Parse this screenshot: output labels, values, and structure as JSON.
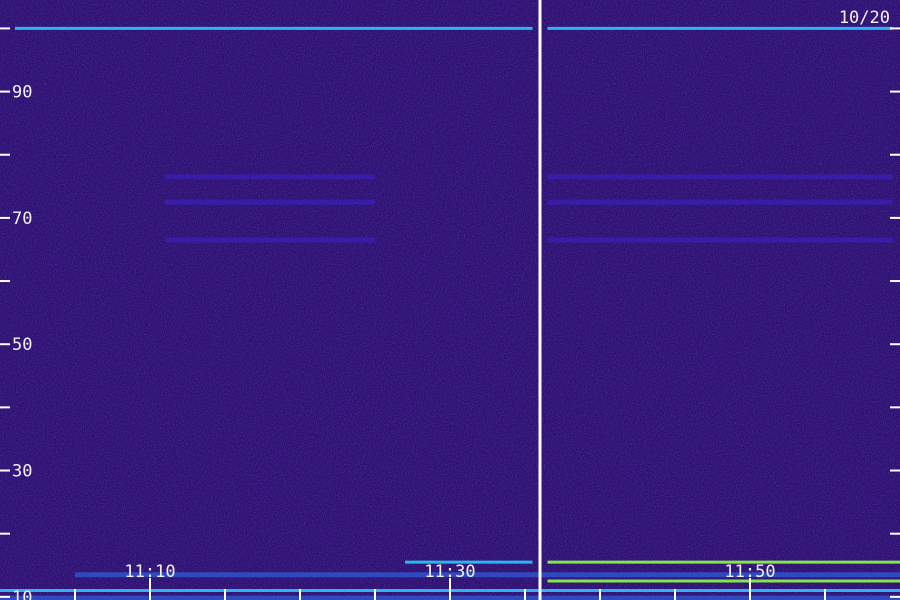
{
  "chart_data": {
    "type": "heatmap",
    "title": "",
    "date_label": "10/20",
    "xlabel": "",
    "ylabel": "",
    "x_tick_labels": [
      "11:10",
      "11:30",
      "11:50"
    ],
    "y_tick_labels": [
      "10",
      "30",
      "50",
      "70",
      "90"
    ],
    "y_major_ticks": [
      10,
      30,
      50,
      70,
      90
    ],
    "y_minor_ticks": [
      20,
      40,
      60,
      80,
      100
    ],
    "ylim": [
      9.5,
      104.5
    ],
    "xlim_minutes": [
      60,
      120
    ],
    "x_major_tick_minutes": [
      70,
      90,
      110
    ],
    "x_minor_tick_minutes": [
      65,
      75,
      80,
      85,
      95,
      100,
      105,
      115
    ],
    "gap_line_minute": 96,
    "colormap": [
      "#140a3a",
      "#2d1384",
      "#3a22c8",
      "#2d6df0",
      "#28c8ff",
      "#88ff44"
    ],
    "background_color": "#2a0f6e",
    "axis_color": "#ffffff",
    "signals": [
      {
        "y": 100,
        "x_start": 61,
        "x_end": 95.5,
        "intensity": 0.75
      },
      {
        "y": 100,
        "x_start": 96.5,
        "x_end": 119.5,
        "intensity": 0.8
      },
      {
        "y": 66.5,
        "x_start": 71,
        "x_end": 85,
        "intensity": 0.45
      },
      {
        "y": 66.5,
        "x_start": 96.5,
        "x_end": 119.5,
        "intensity": 0.35
      },
      {
        "y": 72.5,
        "x_start": 71,
        "x_end": 85,
        "intensity": 0.45
      },
      {
        "y": 72.5,
        "x_start": 96.5,
        "x_end": 119.5,
        "intensity": 0.4
      },
      {
        "y": 76.5,
        "x_start": 71,
        "x_end": 85,
        "intensity": 0.3
      },
      {
        "y": 76.5,
        "x_start": 96.5,
        "x_end": 119.5,
        "intensity": 0.3
      },
      {
        "y": 15.5,
        "x_start": 87,
        "x_end": 95.5,
        "intensity": 0.85
      },
      {
        "y": 15.5,
        "x_start": 96.5,
        "x_end": 120,
        "intensity": 0.95
      },
      {
        "y": 11,
        "x_start": 60,
        "x_end": 120,
        "intensity": 0.7
      },
      {
        "y": 12.5,
        "x_start": 96.5,
        "x_end": 120,
        "intensity": 0.9
      },
      {
        "y": 13.5,
        "x_start": 65,
        "x_end": 120,
        "intensity": 0.6
      },
      {
        "y": 9.8,
        "x_start": 60,
        "x_end": 120,
        "intensity": 0.55
      }
    ]
  }
}
